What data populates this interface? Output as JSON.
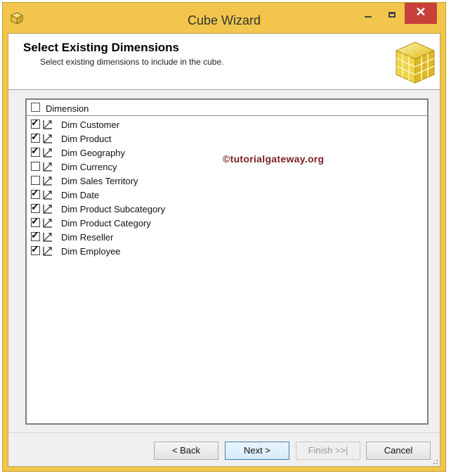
{
  "window": {
    "title": "Cube Wizard",
    "close_glyph": "✕"
  },
  "header": {
    "title": "Select Existing Dimensions",
    "subtitle": "Select existing dimensions to include in the cube."
  },
  "grid": {
    "column_header": "Dimension",
    "header_checked": false,
    "rows": [
      {
        "label": "Dim Customer",
        "checked": true
      },
      {
        "label": "Dim Product",
        "checked": true
      },
      {
        "label": "Dim Geography",
        "checked": true
      },
      {
        "label": "Dim Currency",
        "checked": false
      },
      {
        "label": "Dim Sales Territory",
        "checked": false
      },
      {
        "label": "Dim Date",
        "checked": true
      },
      {
        "label": "Dim Product Subcategory",
        "checked": true
      },
      {
        "label": "Dim Product Category",
        "checked": true
      },
      {
        "label": "Dim Reseller",
        "checked": true
      },
      {
        "label": "Dim Employee",
        "checked": true
      }
    ]
  },
  "watermark": "©tutorialgateway.org",
  "buttons": {
    "back": "< Back",
    "next": "Next >",
    "finish": "Finish >>|",
    "cancel": "Cancel"
  },
  "colors": {
    "title_bar": "#f2c64c",
    "close_button": "#c9403a",
    "watermark": "#7a1f1f"
  },
  "icons": {
    "app": "cube-icon",
    "dimension": "dimension-icon",
    "header_graphic": "cube-grid-icon"
  }
}
